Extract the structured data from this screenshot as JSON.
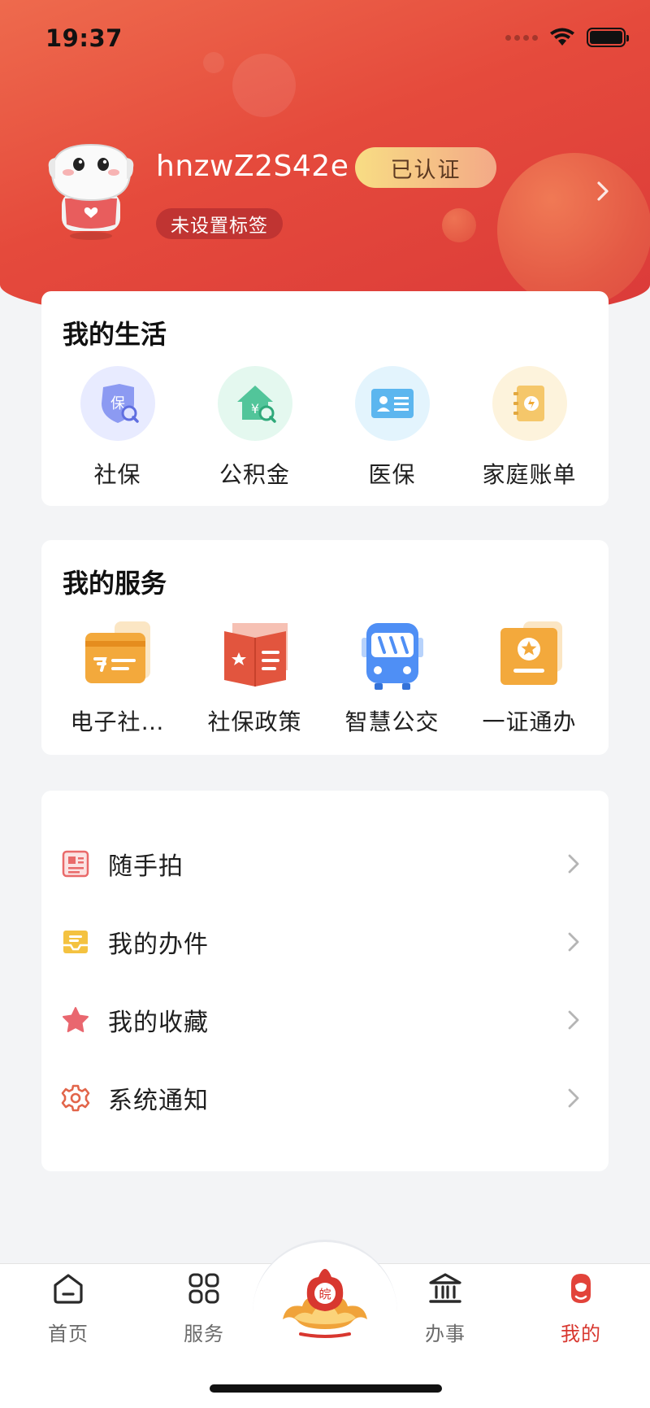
{
  "status_bar": {
    "time": "19:37"
  },
  "profile": {
    "username": "hnzwZ2S42e",
    "verified_label": "已认证",
    "tag_label": "未设置标签"
  },
  "my_life": {
    "title": "我的生活",
    "items": [
      {
        "label": "社保",
        "icon": "social-security-shield-icon"
      },
      {
        "label": "公积金",
        "icon": "housing-fund-icon"
      },
      {
        "label": "医保",
        "icon": "medical-insurance-card-icon"
      },
      {
        "label": "家庭账单",
        "icon": "family-bill-icon"
      }
    ]
  },
  "my_services": {
    "title": "我的服务",
    "items": [
      {
        "label": "电子社…",
        "icon": "e-social-security-card-icon"
      },
      {
        "label": "社保政策",
        "icon": "policy-book-icon"
      },
      {
        "label": "智慧公交",
        "icon": "bus-icon"
      },
      {
        "label": "一证通办",
        "icon": "certificate-icon"
      }
    ]
  },
  "menu": {
    "items": [
      {
        "label": "随手拍",
        "icon": "photo-report-icon"
      },
      {
        "label": "我的办件",
        "icon": "inbox-icon"
      },
      {
        "label": "我的收藏",
        "icon": "star-icon"
      },
      {
        "label": "系统通知",
        "icon": "gear-icon"
      }
    ]
  },
  "tabbar": {
    "tabs": [
      {
        "label": "首页",
        "icon": "home-icon",
        "active": false
      },
      {
        "label": "服务",
        "icon": "grid-icon",
        "active": false
      },
      {
        "label": "办事",
        "icon": "bank-icon",
        "active": false
      },
      {
        "label": "我的",
        "icon": "profile-mascot-icon",
        "active": true
      }
    ],
    "center_icon": "app-logo-icon"
  },
  "colors": {
    "accent": "#d8372f",
    "header_gradient_start": "#ee6a4d",
    "header_gradient_end": "#db3a39",
    "badge_gold": "#f8dd84"
  }
}
